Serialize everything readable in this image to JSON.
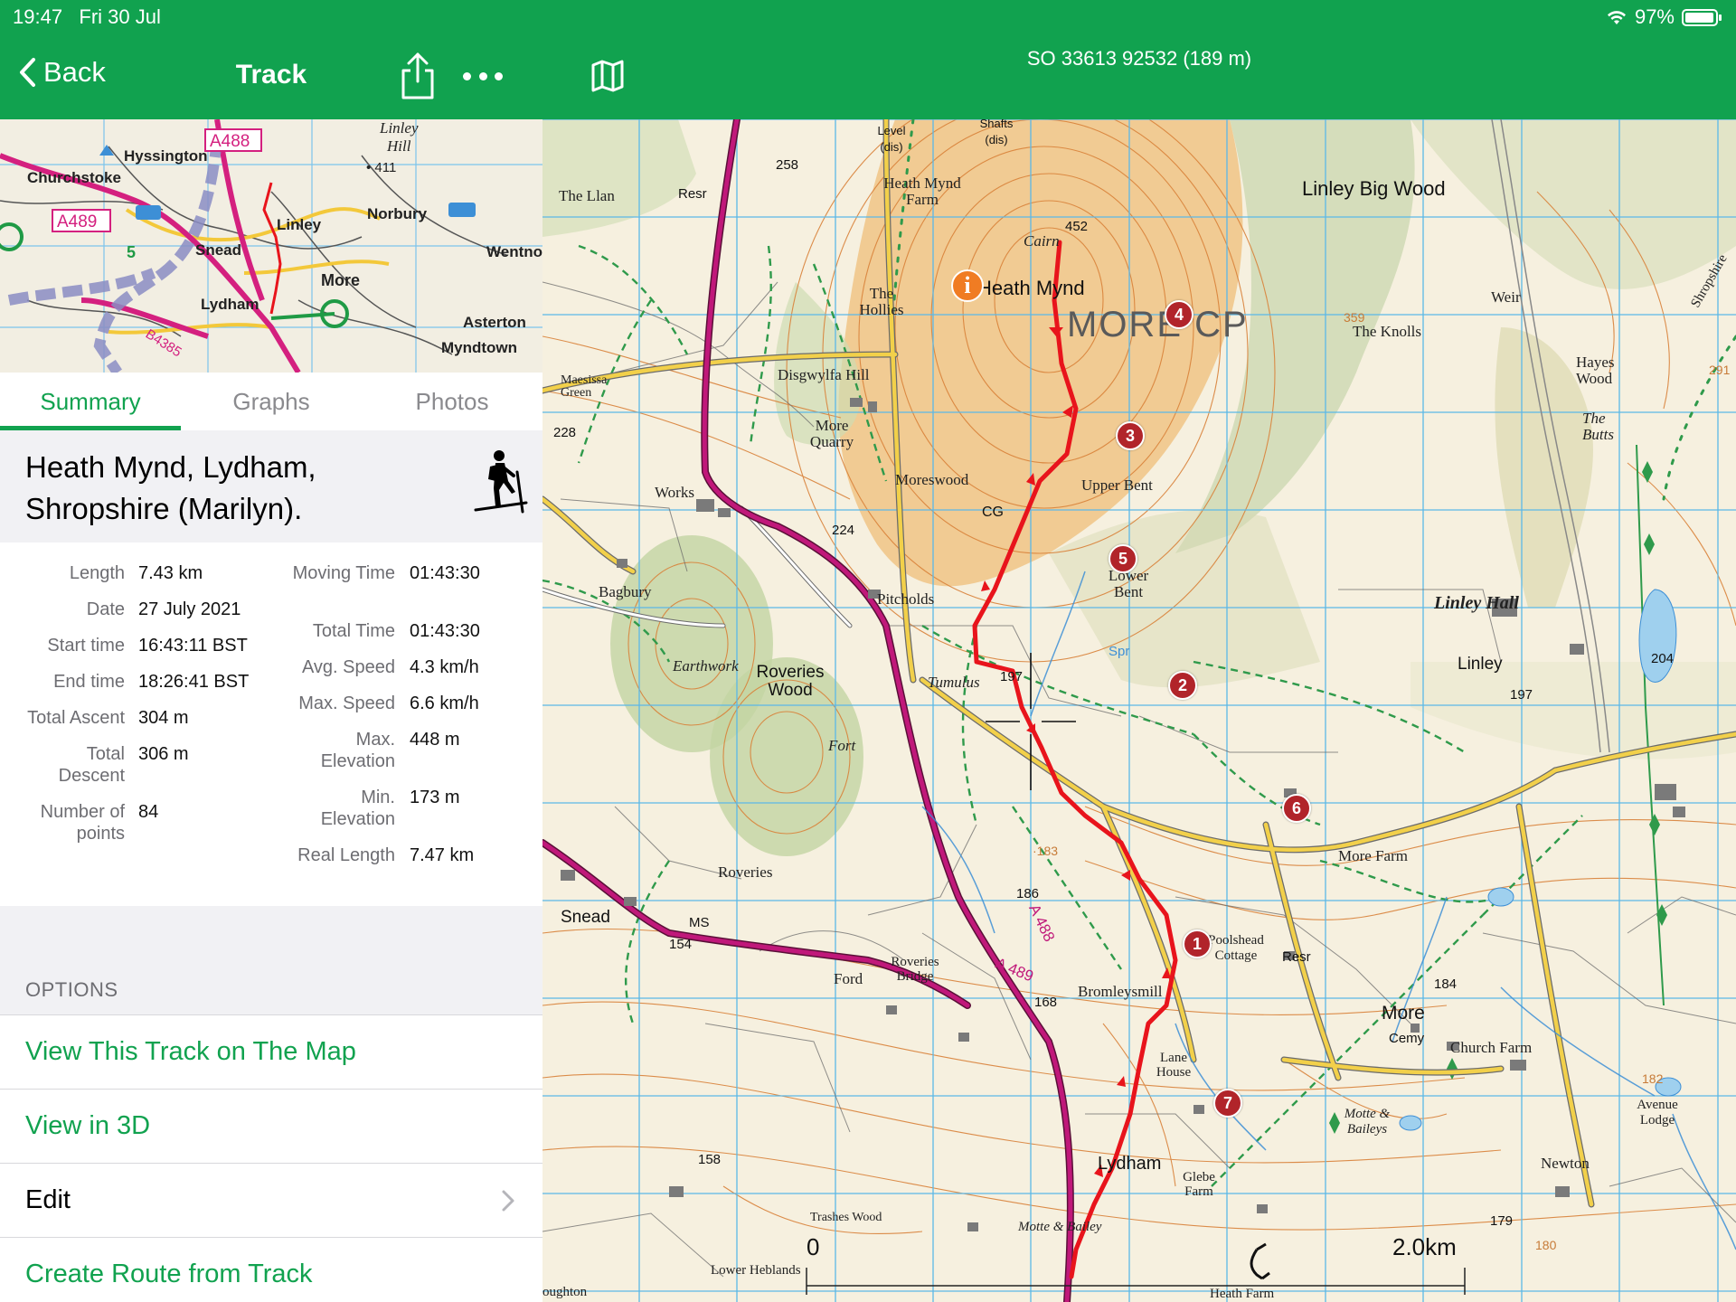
{
  "status_bar": {
    "time": "19:47",
    "date": "Fri 30 Jul",
    "battery": "97%",
    "battery_level": 0.97
  },
  "nav": {
    "back_label": "Back",
    "title": "Track"
  },
  "map_header": {
    "coords": "SO 33613 92532  (189 m)"
  },
  "overview_map": {
    "labels": [
      "Linley",
      "Hill",
      "411",
      "Hyssington",
      "A488",
      "Churchstoke",
      "A489",
      "Linley",
      "Norbury",
      "Wentno",
      "Snead",
      "More",
      "Lydham",
      "B4385",
      "Asterton",
      "Myndtown",
      "5"
    ]
  },
  "tabs": [
    {
      "label": "Summary",
      "active": true
    },
    {
      "label": "Graphs",
      "active": false
    },
    {
      "label": "Photos",
      "active": false
    }
  ],
  "track": {
    "title": "Heath Mynd, Lydham, Shropshire (Marilyn).",
    "activity_icon": "hiker-icon"
  },
  "stats_left": [
    {
      "label": "Length",
      "value": "7.43 km"
    },
    {
      "label": "Date",
      "value": "27 July 2021"
    },
    {
      "label": "Start time",
      "value": "16:43:11 BST"
    },
    {
      "label": "End time",
      "value": "18:26:41 BST"
    },
    {
      "label": "Total Ascent",
      "value": "304 m"
    },
    {
      "label": "Total Descent",
      "value": "306 m"
    },
    {
      "label": "Number of points",
      "value": "84"
    }
  ],
  "stats_right": [
    {
      "label": "Moving Time",
      "value": "01:43:30"
    },
    {
      "label": "Total Time",
      "value": "01:43:30"
    },
    {
      "label": "Avg. Speed",
      "value": "4.3 km/h"
    },
    {
      "label": "Max. Speed",
      "value": "6.6 km/h"
    },
    {
      "label": "Max. Elevation",
      "value": "448 m"
    },
    {
      "label": "Min. Elevation",
      "value": "173 m"
    },
    {
      "label": "Real Length",
      "value": "7.47 km"
    }
  ],
  "options": {
    "header": "OPTIONS",
    "items": [
      {
        "label": "View This Track on The Map",
        "style": "green"
      },
      {
        "label": "View in 3D",
        "style": "green"
      },
      {
        "label": "Edit",
        "style": "black",
        "has_chevron": true
      },
      {
        "label": "Create Route from Track",
        "style": "green"
      }
    ]
  },
  "map": {
    "labels": {
      "heath_mynd": "Heath Mynd",
      "more_cp": "MORE CP",
      "linley_big_wood": "Linley Big Wood",
      "the_knolls": "The Knolls",
      "hayes_wood": "Hayes Wood",
      "the_butts": "The Butts",
      "weir": "Weir",
      "shropshire": "Shropshire",
      "cairn": "Cairn",
      "spot_452": "452",
      "heath_mynd_farm": "Heath Mynd Farm",
      "level_dis": "Level (dis)",
      "shafts_dis": "Shafts (dis)",
      "the_llan": "The Llan",
      "resr": "Resr",
      "spot_258": "258",
      "the_hollies": "The Hollies",
      "maesissa_green": "Maesissa Green",
      "disgwylfa_hill": "Disgwylfa Hill",
      "more_quarry": "More Quarry",
      "moreswood": "Moreswood",
      "works": "Works",
      "upper_bent": "Upper Bent",
      "lower_bent": "Lower Bent",
      "cg": "CG",
      "spot_228": "228",
      "spot_224": "224",
      "bagbury": "Bagbury",
      "pitcholds": "Pitcholds",
      "earthwork": "Earthwork",
      "roveries_wood": "Roveries Wood",
      "tumulus": "Tumulus",
      "spot_197": "197",
      "fort": "Fort",
      "linley_hall": "Linley Hall",
      "linley": "Linley",
      "spot_204": "204",
      "spot_197b": "197",
      "spr": "Spr",
      "roveries": "Roveries",
      "more_farm": "More Farm",
      "snead": "Snead",
      "ms": "MS",
      "spot_154": "154",
      "spot_186": "186",
      "a488": "A 488",
      "a489": "A 489",
      "poolshead_cottage": "Poolshead Cottage",
      "ford": "Ford",
      "roveries_bridge": "Roveries Bridge",
      "bromleysmill": "Bromleysmill",
      "spot_168": "168",
      "more": "More",
      "cemy": "Cemy",
      "church_farm": "Church Farm",
      "spot_184": "184",
      "lane_house": "Lane House",
      "motte_baileys": "Motte & Baileys",
      "avenue_lodge": "Avenue Lodge",
      "spot_182": "182",
      "lydham": "Lydham",
      "glebe_farm": "Glebe Farm",
      "newton": "Newton",
      "spot_158": "158",
      "trashes_wood": "Trashes Wood",
      "motte_bailey": "Motte & Bailey",
      "spot_179": "179",
      "spot_180": "180",
      "lower_heblands": "Lower Heblands",
      "heath_farm": "Heath Farm",
      "oughton": "oughton",
      "spot_183": "·183",
      "spot_359": "359",
      "spot_291": "291"
    },
    "waypoints": [
      "1",
      "2",
      "3",
      "4",
      "5",
      "6",
      "7"
    ],
    "scale": {
      "start": "0",
      "end": "2.0km"
    },
    "colors": {
      "track": "#e8141c",
      "waypoint": "#b1242a",
      "green_bar": "#11a24f",
      "road_a": "#c0187a",
      "contour": "#d9823a",
      "grid": "#5bb8e8"
    }
  }
}
